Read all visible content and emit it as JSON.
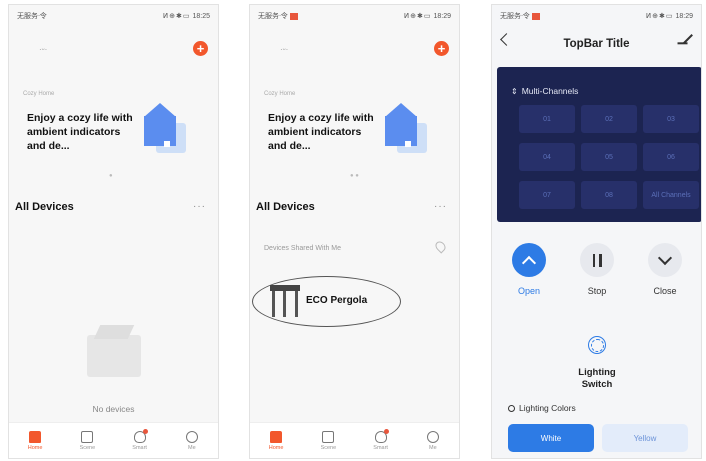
{
  "screens": [
    {
      "status": {
        "carrier": "无服务ᐧ令",
        "time": "18:25",
        "icons": "ⵍ⊕✱▭"
      },
      "home_name": "·ᵕ·",
      "banner": {
        "small": "Cozy Home",
        "title": "Enjoy a cozy life with ambient indicators and de..."
      },
      "section_title": "All Devices",
      "more": "···",
      "empty_text": "No devices",
      "tabs": [
        {
          "label": "Home",
          "icon": "home-icon"
        },
        {
          "label": "Scene",
          "icon": "scene-icon"
        },
        {
          "label": "Smart",
          "icon": "smart-icon"
        },
        {
          "label": "Me",
          "icon": "me-icon"
        }
      ]
    },
    {
      "status": {
        "carrier": "无服务ᐧ令",
        "time": "18:29",
        "icons": "ⵍ⊕✱▭"
      },
      "home_name": "·ᵕ·",
      "banner": {
        "small": "Cozy Home",
        "title": "Enjoy a cozy life with ambient indicators and de..."
      },
      "section_title": "All Devices",
      "more": "···",
      "shared_label": "Devices Shared With Me",
      "device_name": "ECO Pergola",
      "tabs": [
        {
          "label": "Home",
          "icon": "home-icon"
        },
        {
          "label": "Scene",
          "icon": "scene-icon"
        },
        {
          "label": "Smart",
          "icon": "smart-icon"
        },
        {
          "label": "Me",
          "icon": "me-icon"
        }
      ]
    },
    {
      "status": {
        "carrier": "无服务ᐧ令",
        "time": "18:29",
        "icons": "ⵍ⊕✱▭"
      },
      "topbar_title": "TopBar Title",
      "channels_title": "Multi-Channels",
      "channels": [
        "01",
        "02",
        "03",
        "04",
        "05",
        "06",
        "07",
        "08",
        "All Channels"
      ],
      "controls": {
        "open": "Open",
        "stop": "Stop",
        "close": "Close"
      },
      "lighting_label": "Lighting Switch",
      "colors_title": "Lighting Colors",
      "color_white": "White",
      "color_yellow": "Yellow"
    }
  ]
}
